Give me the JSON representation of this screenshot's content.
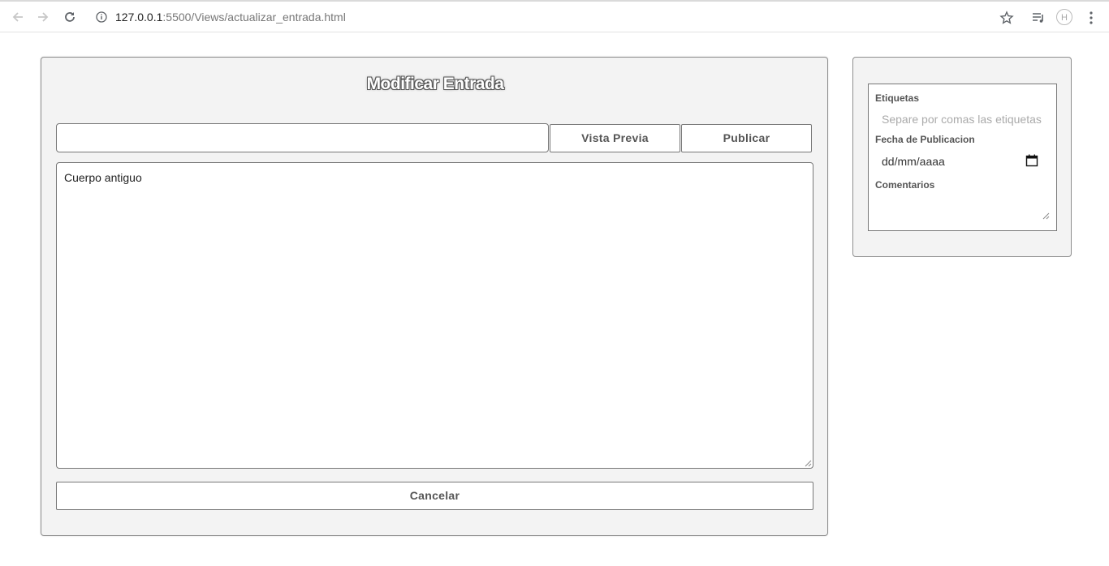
{
  "browser": {
    "url_host": "127.0.0.1",
    "url_rest": ":5500/Views/actualizar_entrada.html",
    "extension_label": "H"
  },
  "editor": {
    "title": "Modificar Entrada",
    "title_input_value": "",
    "preview_label": "Vista Previa",
    "publish_label": "Publicar",
    "body_value": "Cuerpo antiguo",
    "cancel_label": "Cancelar"
  },
  "sidebar": {
    "tags_label": "Etiquetas",
    "tags_placeholder": "Separe por comas las etiquetas",
    "date_label": "Fecha de Publicacion",
    "date_placeholder": "dd/mm/aaaa",
    "comments_label": "Comentarios",
    "comments_value": ""
  }
}
